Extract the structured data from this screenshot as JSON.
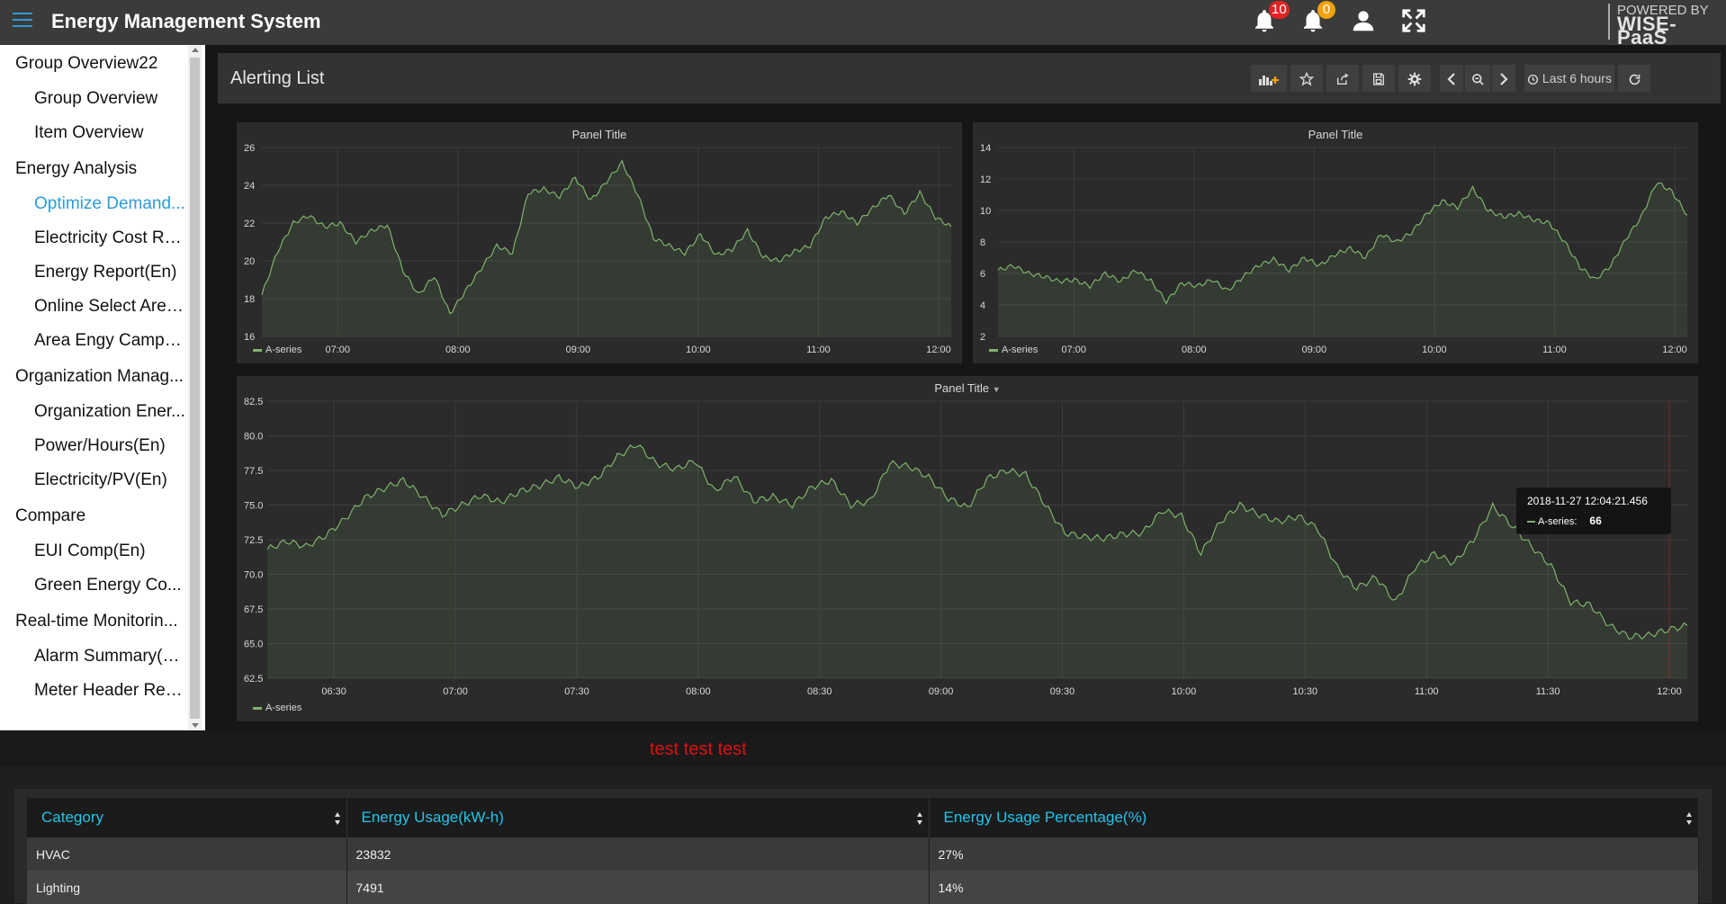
{
  "header": {
    "title": "Energy Management System",
    "alarm_count_1": "10",
    "alarm_count_2": "0",
    "powered_by": "POWERED BY",
    "brand": "WISE-PaaS",
    "icons": [
      "menu-icon",
      "bell-icon",
      "bell-icon",
      "user-icon",
      "fullscreen-icon"
    ]
  },
  "sidebar": {
    "groups": [
      {
        "label": "Group Overview22",
        "items": [
          {
            "label": "Group Overview"
          },
          {
            "label": "Item Overview"
          }
        ]
      },
      {
        "label": "Energy Analysis",
        "items": [
          {
            "label": "Optimize Demand...",
            "active": true
          },
          {
            "label": "Electricity Cost Re..."
          },
          {
            "label": "Energy Report(En)"
          },
          {
            "label": "Online Select Area..."
          },
          {
            "label": "Area Engy Camp(E..."
          }
        ]
      },
      {
        "label": "Organization Manag...",
        "items": [
          {
            "label": "Organization Ener..."
          },
          {
            "label": "Power/Hours(En)"
          },
          {
            "label": "Electricity/PV(En)"
          }
        ]
      },
      {
        "label": "Compare",
        "items": [
          {
            "label": "EUI Comp(En)"
          },
          {
            "label": "Green Energy Co..."
          }
        ]
      },
      {
        "label": "Real-time Monitorin...",
        "items": [
          {
            "label": "Alarm Summary(En)"
          },
          {
            "label": "Meter Header Rep..."
          }
        ]
      }
    ]
  },
  "dashboard": {
    "title": "Alerting List",
    "time_range": "Last 6 hours",
    "toolbar_icons": [
      "add-panel-icon",
      "star-icon",
      "share-icon",
      "save-icon",
      "gear-icon",
      "chevron-left-icon",
      "zoom-out-icon",
      "chevron-right-icon",
      "clock-icon",
      "refresh-icon"
    ]
  },
  "panels": {
    "top_left": {
      "title": "Panel Title",
      "legend": "A-series"
    },
    "top_right": {
      "title": "Panel Title",
      "legend": "A-series"
    },
    "bottom": {
      "title": "Panel Title",
      "legend": "A-series"
    }
  },
  "chart_data": [
    {
      "type": "line",
      "title": "Panel Title",
      "ylim": [
        16,
        26
      ],
      "y_ticks": [
        "26",
        "24",
        "22",
        "20",
        "18",
        "16"
      ],
      "x_ticks": [
        "07:00",
        "08:00",
        "09:00",
        "10:00",
        "11:00",
        "12:00"
      ],
      "series": [
        {
          "name": "A-series",
          "values": [
            18.2,
            20.5,
            22.0,
            22.4,
            21.8,
            22.0,
            21.0,
            21.6,
            21.9,
            19.5,
            18.2,
            19.2,
            17.2,
            18.4,
            19.6,
            20.8,
            20.4,
            23.6,
            23.8,
            23.4,
            24.4,
            23.2,
            24.2,
            25.2,
            23.5,
            21.2,
            20.8,
            20.4,
            21.4,
            20.3,
            20.6,
            21.6,
            20.2,
            20.0,
            20.5,
            20.8,
            22.3,
            22.6,
            22.0,
            22.8,
            23.5,
            22.5,
            23.6,
            22.3,
            21.8
          ]
        }
      ],
      "legend": "bottom-left",
      "grid": true
    },
    {
      "type": "line",
      "title": "Panel Title",
      "ylim": [
        2,
        14
      ],
      "y_ticks": [
        "14",
        "12",
        "10",
        "8",
        "6",
        "4",
        "2"
      ],
      "x_ticks": [
        "07:00",
        "08:00",
        "09:00",
        "10:00",
        "11:00",
        "12:00"
      ],
      "series": [
        {
          "name": "A-series",
          "values": [
            6.2,
            6.5,
            6.0,
            5.8,
            5.5,
            5.6,
            5.2,
            6.0,
            5.5,
            6.2,
            5.5,
            4.2,
            5.4,
            5.2,
            5.6,
            4.9,
            5.8,
            6.5,
            6.9,
            6.2,
            7.0,
            6.5,
            7.2,
            7.6,
            7.0,
            8.5,
            8.0,
            8.6,
            9.8,
            10.6,
            10.2,
            11.4,
            10.0,
            9.6,
            9.8,
            9.4,
            9.2,
            8.0,
            6.4,
            5.6,
            6.5,
            8.2,
            9.6,
            11.8,
            11.2,
            9.7
          ]
        }
      ],
      "legend": "bottom-left",
      "grid": true
    },
    {
      "type": "line",
      "title": "Panel Title",
      "ylim": [
        62.5,
        82.5
      ],
      "y_ticks": [
        "82.5",
        "80.0",
        "77.5",
        "75.0",
        "72.5",
        "70.0",
        "67.5",
        "65.0",
        "62.5"
      ],
      "x_ticks": [
        "06:30",
        "07:00",
        "07:30",
        "08:00",
        "08:30",
        "09:00",
        "09:30",
        "10:00",
        "10:30",
        "11:00",
        "11:30",
        "12:00"
      ],
      "series": [
        {
          "name": "A-series",
          "values": [
            71.8,
            72.4,
            72.0,
            72.8,
            74.0,
            75.5,
            76.2,
            76.8,
            75.6,
            74.3,
            75.0,
            75.7,
            75.2,
            76.0,
            76.4,
            77.0,
            76.3,
            77.0,
            78.5,
            79.4,
            78.0,
            77.6,
            78.2,
            76.0,
            77.1,
            75.3,
            75.6,
            75.0,
            76.3,
            76.8,
            75.0,
            75.3,
            78.0,
            77.8,
            77.0,
            75.5,
            74.8,
            76.9,
            77.5,
            77.2,
            75.0,
            73.0,
            72.7,
            72.6,
            72.9,
            73.0,
            74.6,
            74.2,
            71.5,
            73.8,
            75.0,
            74.3,
            73.8,
            74.2,
            73.3,
            70.5,
            69.0,
            69.8,
            68.0,
            70.5,
            71.5,
            70.8,
            72.5,
            74.9,
            73.5,
            72.0,
            70.6,
            68.0,
            67.8,
            66.3,
            65.5,
            65.6,
            66.0,
            66.3
          ]
        }
      ],
      "legend": "bottom-left",
      "grid": true
    }
  ],
  "tooltip": {
    "time": "2018-11-27 12:04:21.456",
    "series": "A-series:",
    "value": "66"
  },
  "note_text": "test test test",
  "table": {
    "headers": [
      "Category",
      "Energy Usage(kW-h)",
      "Energy Usage Percentage(%)"
    ],
    "rows": [
      [
        "HVAC",
        "23832",
        "27%"
      ],
      [
        "Lighting",
        "7491",
        "14%"
      ]
    ]
  },
  "colors": {
    "accent": "#2d9bd9",
    "series": "#7eb26d",
    "header_text": "#22c4ea",
    "badge_red": "#e02424",
    "badge_orange": "#f0a30a",
    "alert_text": "#dd1111"
  }
}
